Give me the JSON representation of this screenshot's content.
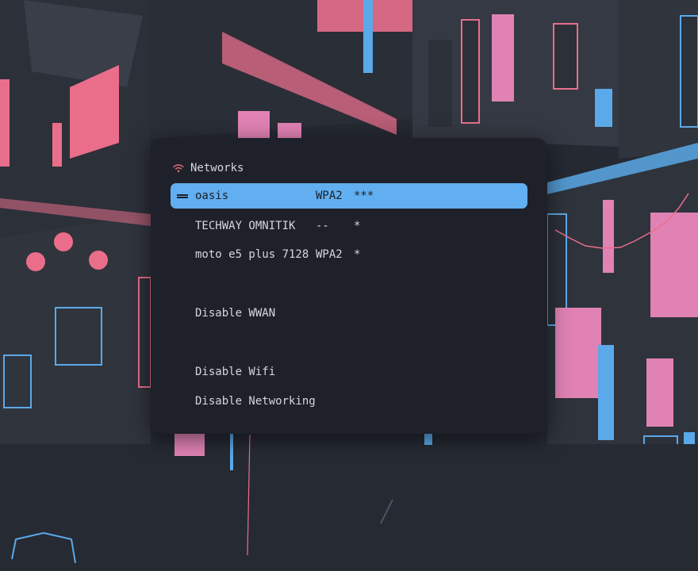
{
  "prompt": {
    "label": "Networks",
    "icon": "wifi-icon",
    "icon_color": "#e06c75"
  },
  "networks": [
    {
      "ssid": "oasis",
      "security": "WPA2",
      "signal": "***",
      "selected": true
    },
    {
      "ssid": "TECHWAY OMNITIK",
      "security": "--",
      "signal": "*",
      "selected": false
    },
    {
      "ssid": "moto e5 plus 7128",
      "security": "WPA2",
      "signal": "*",
      "selected": false
    }
  ],
  "actions": [
    {
      "label": "Disable WWAN"
    },
    {
      "label": "Disable Wifi"
    },
    {
      "label": "Disable Networking"
    }
  ],
  "theme": {
    "panel_bg": "#1e2129",
    "selection_bg": "#61aef0",
    "text": "#d4d7de"
  }
}
